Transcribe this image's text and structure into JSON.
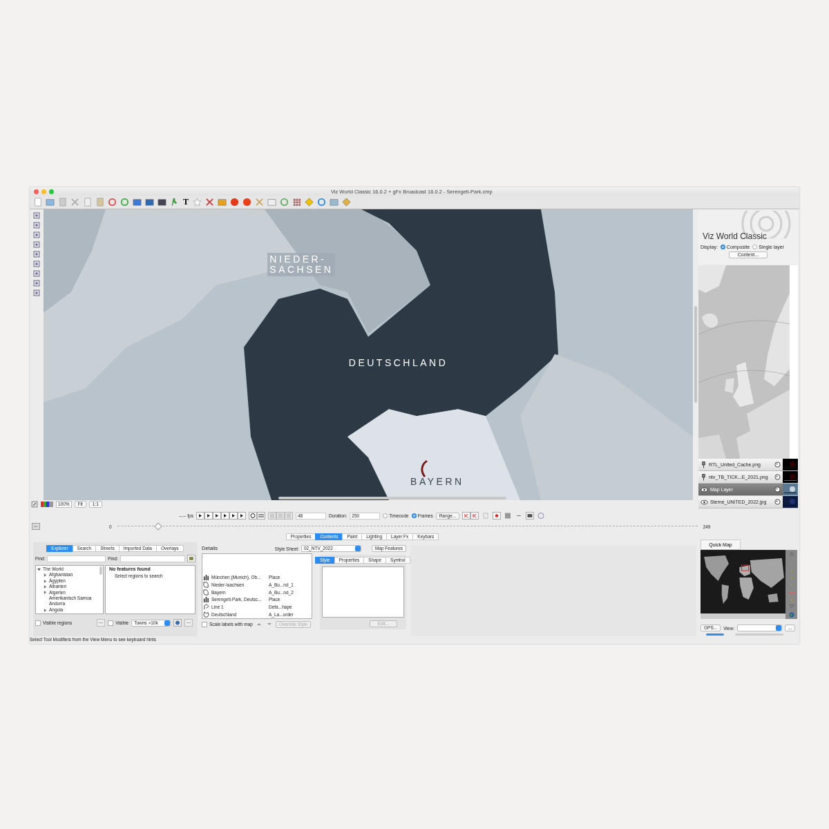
{
  "window": {
    "title": "Viz World Classic 16.0.2  + gFx Broadcast 16.0.2  - Serengeti-Park.cmp"
  },
  "toolbar": {
    "text_tool": "T"
  },
  "map": {
    "labels": [
      {
        "lines": [
          "NIEDER-",
          "SACHSEN"
        ],
        "boxed": true
      },
      {
        "lines": [
          "DEUTSCHLAND"
        ],
        "boxed": false
      },
      {
        "lines": [
          "BAYERN"
        ],
        "boxed": false
      }
    ]
  },
  "zoom_bar": {
    "zoom": "100%",
    "buttons": [
      "Fit",
      "1:1"
    ]
  },
  "playback": {
    "fps": "--.-- fps",
    "frame": "48",
    "duration_label": "Duration:",
    "duration": "250",
    "modes": [
      {
        "label": "Timecode",
        "selected": false
      },
      {
        "label": "Frames",
        "selected": true
      }
    ],
    "range": "Range..."
  },
  "timeline": {
    "start": "0",
    "end": "249",
    "level": 0.07
  },
  "right_panel": {
    "title": "Viz World Classic",
    "display_label": "Display:",
    "display_options": [
      {
        "label": "Composite",
        "selected": true
      },
      {
        "label": "Single layer",
        "selected": false
      }
    ],
    "content_button": "Content...",
    "layers": [
      {
        "name": "RTL_United_Cache.png",
        "kind": "pin",
        "selected": false
      },
      {
        "name": "ntv_TB_TICK...E_2021.png",
        "kind": "pin",
        "selected": false
      },
      {
        "name": "Map Layer",
        "kind": "eye",
        "selected": true
      },
      {
        "name": "Sterne_UNITED_2022.jpg",
        "kind": "eye",
        "selected": false
      }
    ]
  },
  "main_tabs": [
    {
      "label": "Properties",
      "selected": false
    },
    {
      "label": "Contents",
      "selected": true
    },
    {
      "label": "Paint",
      "selected": false
    },
    {
      "label": "Lighting",
      "selected": false
    },
    {
      "label": "Layer Fx",
      "selected": false
    },
    {
      "label": "Keybars",
      "selected": false
    }
  ],
  "explorer": {
    "tabs": [
      {
        "label": "Explorer",
        "selected": true
      },
      {
        "label": "Search",
        "selected": false
      },
      {
        "label": "Streets",
        "selected": false
      },
      {
        "label": "Imported Data",
        "selected": false
      },
      {
        "label": "Overlays",
        "selected": false
      }
    ],
    "find_labels": [
      "Find:",
      "Find:"
    ],
    "tree": {
      "label": "The World",
      "expanded": true,
      "children": [
        {
          "label": "Afghanistan",
          "expanded": false
        },
        {
          "label": "Ägypten",
          "expanded": false
        },
        {
          "label": "Albanien",
          "expanded": false
        },
        {
          "label": "Algerien",
          "expanded": false
        },
        {
          "label": "Amerikanisch Samoa"
        },
        {
          "label": "Andorra"
        },
        {
          "label": "Angola",
          "expanded": false
        }
      ]
    },
    "results": {
      "title": "No features found",
      "hint": "Select regions to search"
    },
    "visible_regions": {
      "label": "Visible regions",
      "checked": false
    },
    "visible": {
      "label": "Visible",
      "checked": false
    },
    "filter": "Towns >10k"
  },
  "details": {
    "title": "Details",
    "style_sheet_label": "Style Sheet:",
    "style_sheet": "02_NTV_2022",
    "map_features": "Map Features",
    "rows": [
      {
        "name": "München (Munich), Ob...",
        "type": "Place",
        "kind": "place"
      },
      {
        "name": "Nieder-\\sachsen",
        "type": "A_Bu...nd_1",
        "kind": "region"
      },
      {
        "name": "Bayern",
        "type": "A_Bu...nd_2",
        "kind": "region"
      },
      {
        "name": "Serengeti-Park, Deutsc...",
        "type": "Place",
        "kind": "place"
      },
      {
        "name": "Line 1",
        "type": "Defa...hape",
        "kind": "line"
      },
      {
        "name": "Deutschland",
        "type": "A_La...order",
        "kind": "country"
      }
    ],
    "scale_labels": {
      "label": "Scale labels with map",
      "checked": false
    },
    "override": "Override Style"
  },
  "style": {
    "tabs": [
      {
        "label": "Style",
        "selected": true
      },
      {
        "label": "Properties",
        "selected": false
      },
      {
        "label": "Shape",
        "selected": false
      },
      {
        "label": "Symbol",
        "selected": false
      }
    ],
    "edit": "Edit..."
  },
  "quick_map": {
    "tab": "Quick Map",
    "gps": "GPS...",
    "view_label": "View:",
    "more": "..."
  },
  "status_bar": "Select Tool Modifiers from the View Menu to see keyboard hints"
}
